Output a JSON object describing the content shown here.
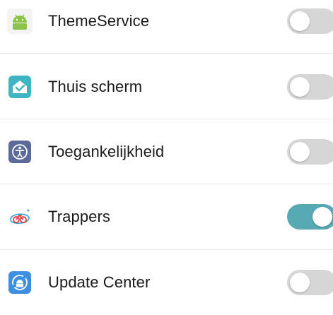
{
  "apps": [
    {
      "name": "ThemeService",
      "icon": "android-icon",
      "enabled": false
    },
    {
      "name": "Thuis scherm",
      "icon": "home-screen-icon",
      "enabled": false
    },
    {
      "name": "Toegankelijkheid",
      "icon": "accessibility-icon",
      "enabled": false
    },
    {
      "name": "Trappers",
      "icon": "bicycle-icon",
      "enabled": true
    },
    {
      "name": "Update Center",
      "icon": "update-center-icon",
      "enabled": false
    }
  ],
  "colors": {
    "toggle_on": "#57a9b4",
    "toggle_off": "#d6d6d6",
    "android_green": "#8bc34a",
    "home_teal": "#3fb5c4",
    "accessibility_purple": "#5b6a9a",
    "trappers_red": "#e23a3a",
    "update_blue": "#3f8fe0"
  }
}
